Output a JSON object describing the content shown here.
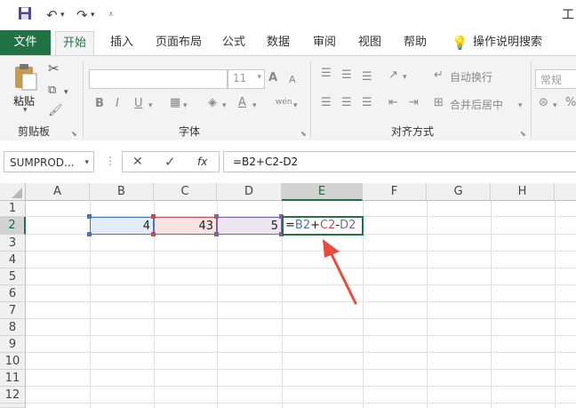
{
  "title_fragment": "工",
  "tabs": [
    "文件",
    "开始",
    "插入",
    "页面布局",
    "公式",
    "数据",
    "审阅",
    "视图",
    "帮助",
    "操作说明搜索"
  ],
  "ribbon": {
    "paste_label": "粘贴",
    "clipboard_label": "剪贴板",
    "font_group_label": "字体",
    "font_size": "11",
    "alignment_group_label": "对齐方式",
    "wrap_text": "自动换行",
    "merge_center": "合并后居中",
    "number_format": "常规",
    "bold": "B",
    "italic": "I",
    "underline": "U",
    "font_grow": "A",
    "font_shrink": "A",
    "phonetic": "wén",
    "font_color": "A"
  },
  "formula_bar": {
    "name_box": "SUMPROD...",
    "fx": "fx",
    "formula": "=B2+C2-D2"
  },
  "columns": [
    "A",
    "B",
    "C",
    "D",
    "E",
    "F",
    "G",
    "H"
  ],
  "rows": [
    "1",
    "2",
    "3",
    "4",
    "5",
    "6",
    "7",
    "8",
    "9",
    "10",
    "11",
    "12"
  ],
  "cells": {
    "B2": "4",
    "C2": "43",
    "D2": "5",
    "E2_parts": [
      "=",
      "B2",
      "+",
      "C2",
      "-",
      "D2"
    ]
  },
  "colors": {
    "excel_green": "#217346",
    "ref_blue": "#4472c4",
    "ref_red": "#c0504d",
    "ref_purple": "#8064a2",
    "arrow": "#e84c3d"
  }
}
